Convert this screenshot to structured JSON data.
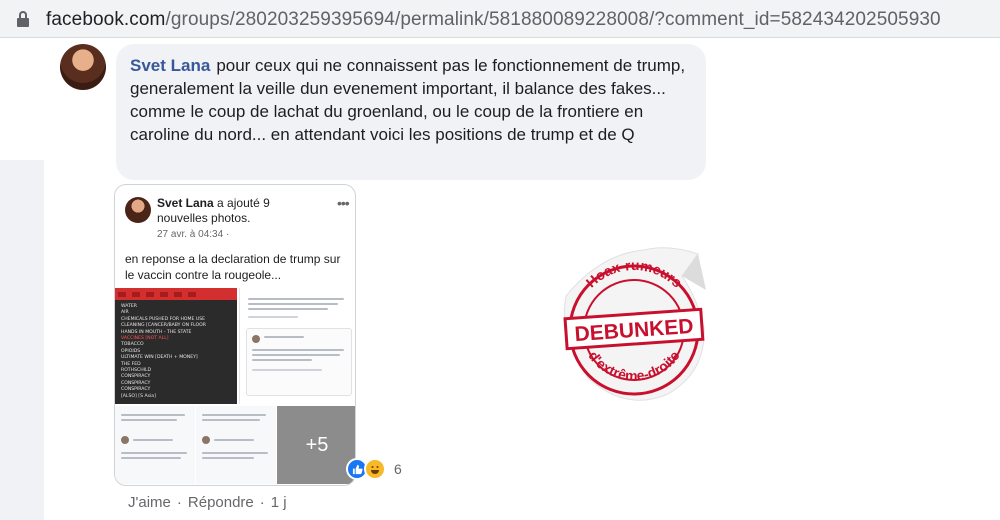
{
  "browser": {
    "url_host": "facebook.com",
    "url_path": "/groups/280203259395694/permalink/581880089228008/?comment_id=582434202505930"
  },
  "comment": {
    "author": "Svet Lana",
    "text": "pour ceux qui ne connaissent pas le fonctionnement de trump, generalement la veille dun evenement important, il balance des fakes... comme le coup de lachat du groenland, ou le coup de la frontiere en caroline du nord... en attendant voici les positions de trump et de Q",
    "actions": {
      "like": "J'aime",
      "reply": "Répondre",
      "time": "1 j"
    },
    "reactions": {
      "count": "6",
      "types": [
        "like-icon",
        "haha-icon"
      ]
    }
  },
  "screenshot_post": {
    "author": "Svet Lana",
    "action": "a ajouté 9 nouvelles photos.",
    "timestamp": "27 avr. à 04:34 ·",
    "text": "en reponse a la declaration de trump sur le vaccin contre la rougeole...",
    "more_photos": "+5",
    "list_lines": [
      "WATER",
      "AIR",
      "CHEMICALS PUSHED FOR HOME USE",
      "CLEANING [CANCER/BABY ON FLOOR",
      "HANDS IN MOUTH - THE STATE",
      "VACCINES [NOT ALL]",
      "TOBACCO",
      "OPIOIDS",
      "ULTIMATE WIN [DEATH + MONEY]",
      "THE FED",
      "ROTHSCHILD",
      "CONSPIRACY",
      "CONSPIRACY",
      "CONSPIRACY",
      "[ALSO] [S Asia]"
    ],
    "list_highlight_index": 5
  },
  "stamp": {
    "top_text": "Hoax-rumeurs",
    "center_text": "DEBUNKED",
    "bottom_text": "d'extrême-droite",
    "color": "#c8102e"
  }
}
